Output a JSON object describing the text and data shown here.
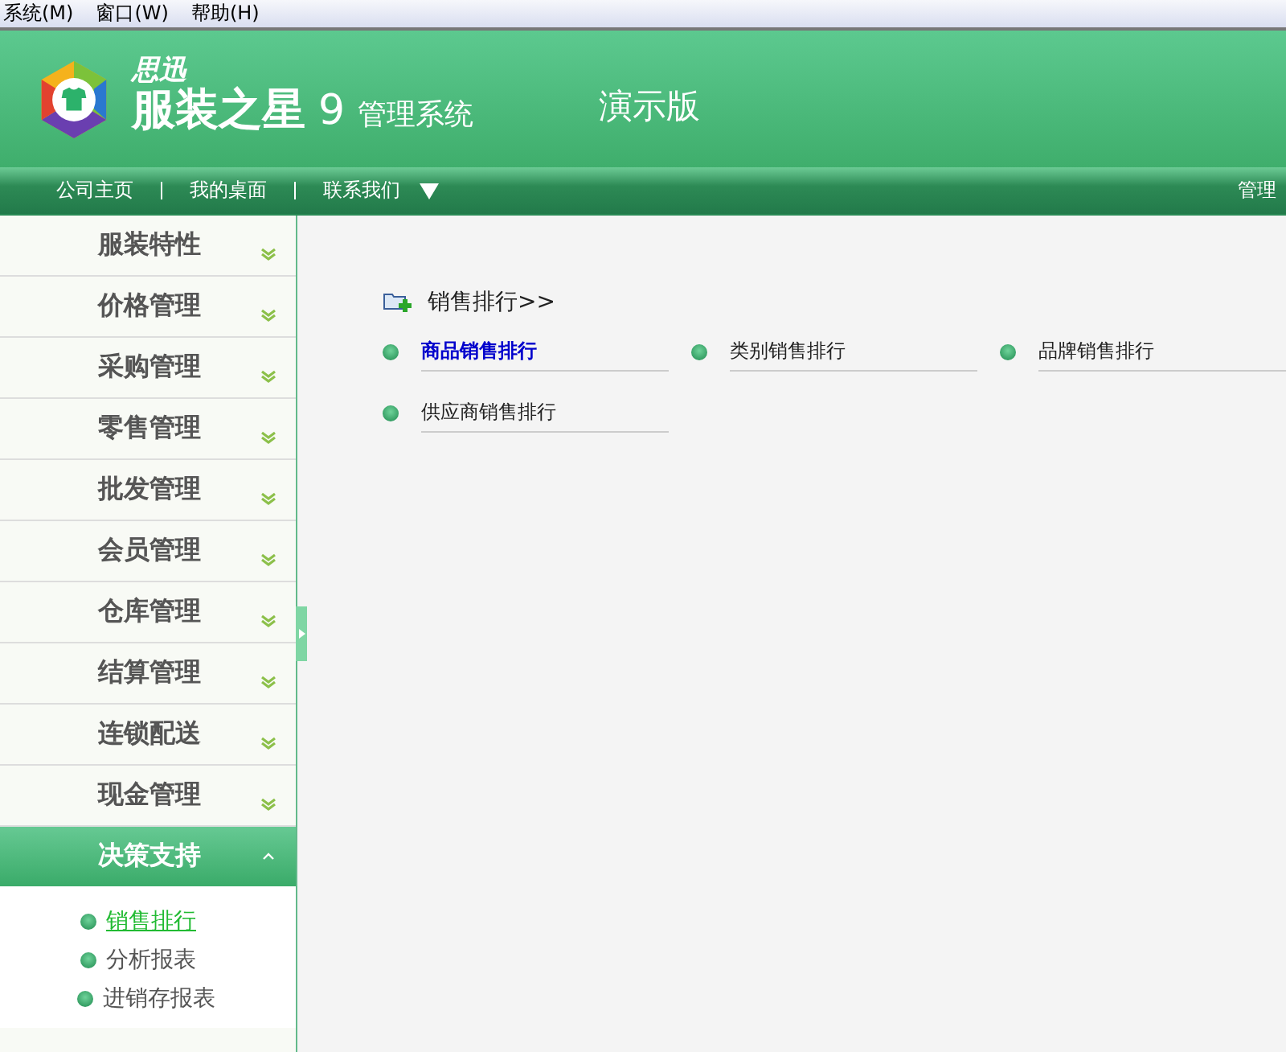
{
  "menu_bar": [
    "系统(M)",
    "窗口(W)",
    "帮助(H)"
  ],
  "header": {
    "brand_small": "思迅",
    "brand_name": "服装之星",
    "version": "9",
    "subtitle": "管理系统",
    "edition": "演示版"
  },
  "nav": {
    "links": [
      "公司主页",
      "我的桌面",
      "联系我们"
    ],
    "user": "管理"
  },
  "sidebar": {
    "items": [
      {
        "label": "服装特性",
        "expanded": false
      },
      {
        "label": "价格管理",
        "expanded": false
      },
      {
        "label": "采购管理",
        "expanded": false
      },
      {
        "label": "零售管理",
        "expanded": false
      },
      {
        "label": "批发管理",
        "expanded": false
      },
      {
        "label": "会员管理",
        "expanded": false
      },
      {
        "label": "仓库管理",
        "expanded": false
      },
      {
        "label": "结算管理",
        "expanded": false
      },
      {
        "label": "连锁配送",
        "expanded": false
      },
      {
        "label": "现金管理",
        "expanded": false
      },
      {
        "label": "决策支持",
        "expanded": true,
        "children": [
          {
            "label": "销售排行",
            "selected": true
          },
          {
            "label": "分析报表",
            "selected": false
          },
          {
            "label": "进销存报表",
            "selected": false
          }
        ]
      }
    ]
  },
  "content": {
    "section_title": "销售排行>>",
    "links": [
      {
        "label": "商品销售排行",
        "selected": true
      },
      {
        "label": "类别销售排行",
        "selected": false
      },
      {
        "label": "品牌销售排行",
        "selected": false
      },
      {
        "label": "供应商销售排行",
        "selected": false
      }
    ]
  }
}
